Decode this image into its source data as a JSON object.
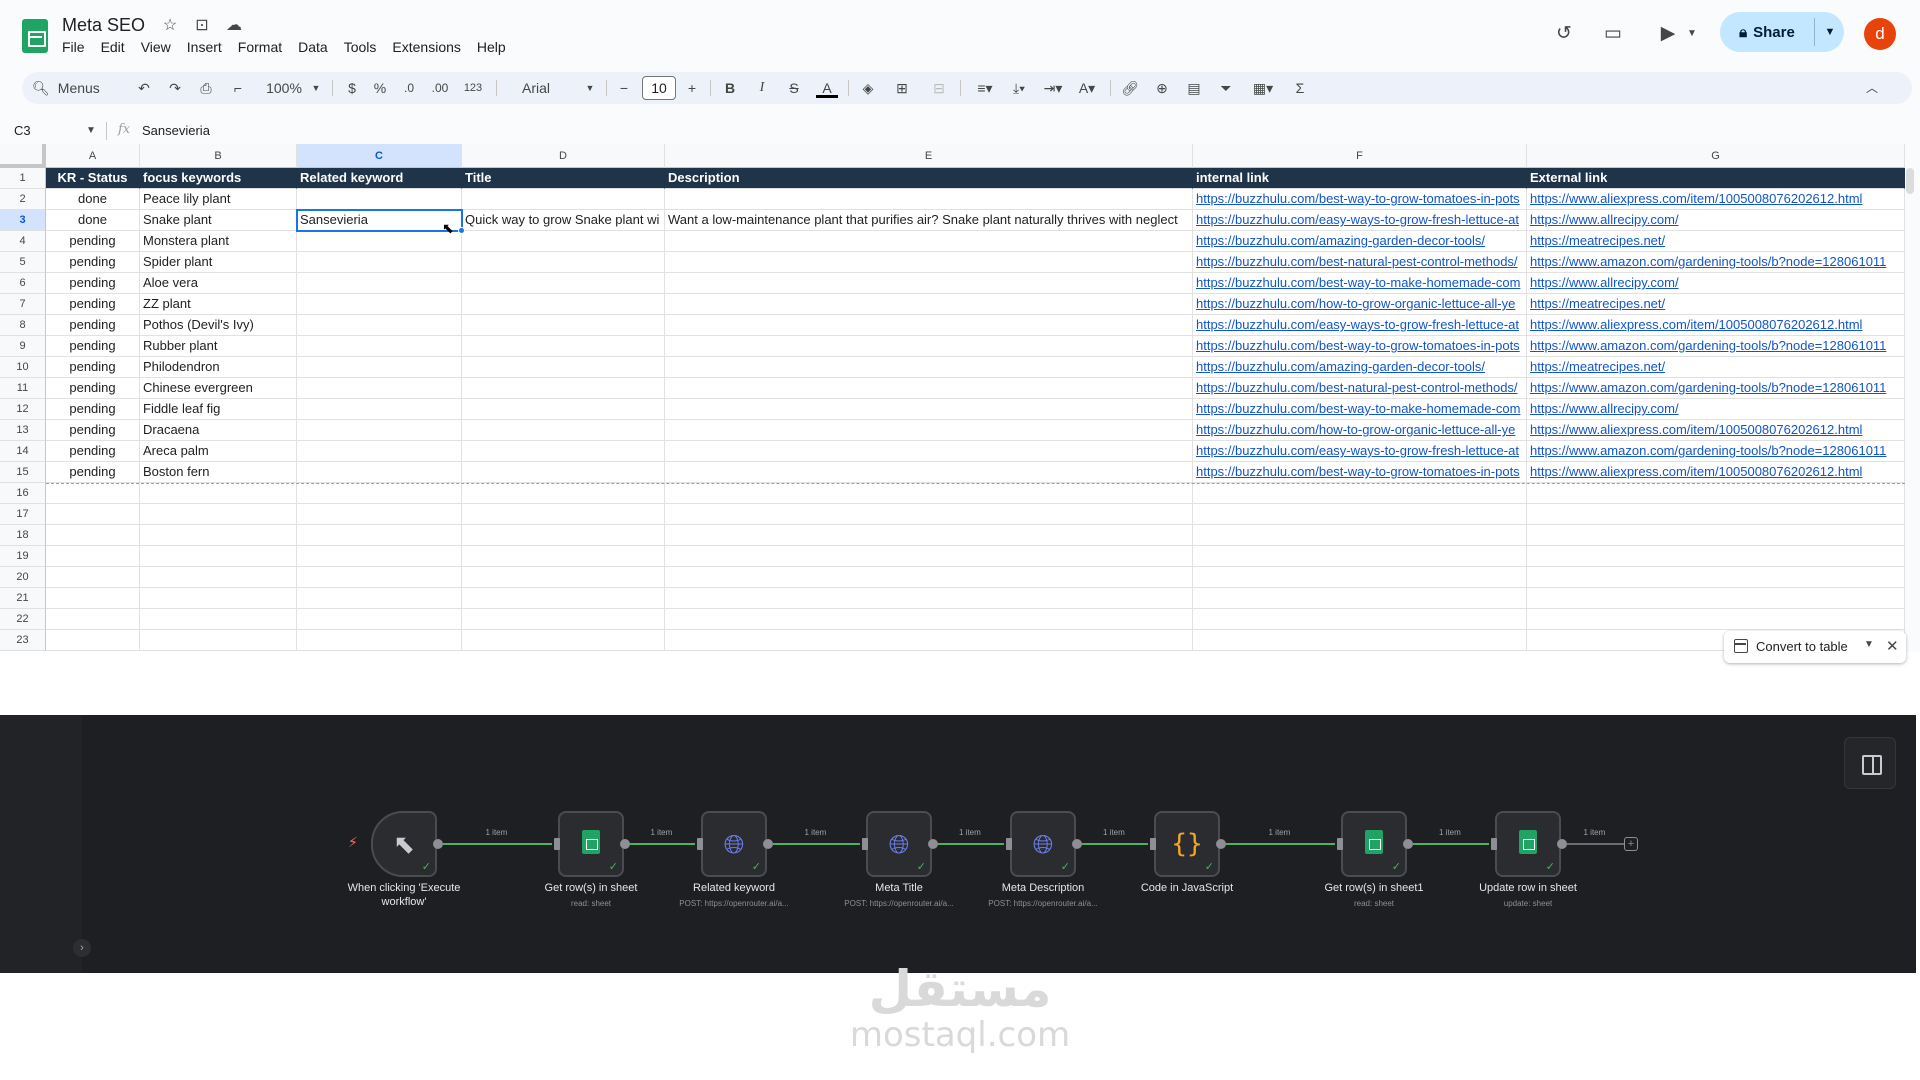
{
  "app": {
    "doc_title": "Meta SEO",
    "menu": [
      "File",
      "Edit",
      "View",
      "Insert",
      "Format",
      "Data",
      "Tools",
      "Extensions",
      "Help"
    ],
    "share_label": "Share",
    "avatar_letter": "d"
  },
  "toolbar": {
    "search_label": "Menus",
    "zoom": "100%",
    "currency": "$",
    "percent": "%",
    "dec_decrease": ".0",
    "dec_increase": ".00",
    "number_format": "123",
    "font": "Arial",
    "font_size": "10",
    "bold": "B",
    "italic": "I",
    "strike": "S",
    "text_color": "A",
    "sigma": "Σ"
  },
  "formula_bar": {
    "cell_ref": "C3",
    "fx": "fx",
    "value": "Sansevieria"
  },
  "grid": {
    "columns": [
      "A",
      "B",
      "C",
      "D",
      "E",
      "F",
      "G"
    ],
    "row_numbers": [
      "1",
      "2",
      "3",
      "4",
      "5",
      "6",
      "7",
      "8",
      "9",
      "10",
      "11",
      "12",
      "13",
      "14",
      "15",
      "16",
      "17",
      "18",
      "19",
      "20",
      "21",
      "22",
      "23"
    ],
    "header_row": [
      "KR -  Status",
      "focus keywords",
      "Related keyword",
      "Title",
      "Description",
      "internal link",
      "External link"
    ],
    "rows": [
      [
        "done",
        "Peace lily plant",
        "",
        "",
        "",
        "https://buzzhulu.com/best-way-to-grow-tomatoes-in-pots",
        "https://www.aliexpress.com/item/1005008076202612.html"
      ],
      [
        "done",
        "Snake plant",
        "Sansevieria",
        "Quick way to grow Snake plant wi",
        "Want a low-maintenance plant that purifies air? Snake plant naturally thrives with neglect",
        "https://buzzhulu.com/easy-ways-to-grow-fresh-lettuce-at",
        "https://www.allrecipy.com/"
      ],
      [
        "pending",
        "Monstera plant",
        "",
        "",
        "",
        "https://buzzhulu.com/amazing-garden-decor-tools/",
        "https://meatrecipes.net/"
      ],
      [
        "pending",
        "Spider plant",
        "",
        "",
        "",
        "https://buzzhulu.com/best-natural-pest-control-methods/",
        "https://www.amazon.com/gardening-tools/b?node=128061011"
      ],
      [
        "pending",
        "Aloe vera",
        "",
        "",
        "",
        "https://buzzhulu.com/best-way-to-make-homemade-com",
        "https://www.allrecipy.com/"
      ],
      [
        "pending",
        "ZZ plant",
        "",
        "",
        "",
        "https://buzzhulu.com/how-to-grow-organic-lettuce-all-ye",
        "https://meatrecipes.net/"
      ],
      [
        "pending",
        "Pothos (Devil's Ivy)",
        "",
        "",
        "",
        "https://buzzhulu.com/easy-ways-to-grow-fresh-lettuce-at",
        "https://www.aliexpress.com/item/1005008076202612.html"
      ],
      [
        "pending",
        "Rubber plant",
        "",
        "",
        "",
        "https://buzzhulu.com/best-way-to-grow-tomatoes-in-pots",
        "https://www.amazon.com/gardening-tools/b?node=128061011"
      ],
      [
        "pending",
        "Philodendron",
        "",
        "",
        "",
        "https://buzzhulu.com/amazing-garden-decor-tools/",
        "https://meatrecipes.net/"
      ],
      [
        "pending",
        "Chinese evergreen",
        "",
        "",
        "",
        "https://buzzhulu.com/best-natural-pest-control-methods/",
        "https://www.amazon.com/gardening-tools/b?node=128061011"
      ],
      [
        "pending",
        "Fiddle leaf fig",
        "",
        "",
        "",
        "https://buzzhulu.com/best-way-to-make-homemade-com",
        "https://www.allrecipy.com/"
      ],
      [
        "pending",
        "Dracaena",
        "",
        "",
        "",
        "https://buzzhulu.com/how-to-grow-organic-lettuce-all-ye",
        "https://www.aliexpress.com/item/1005008076202612.html"
      ],
      [
        "pending",
        "Areca palm",
        "",
        "",
        "",
        "https://buzzhulu.com/easy-ways-to-grow-fresh-lettuce-at",
        "https://www.amazon.com/gardening-tools/b?node=128061011"
      ],
      [
        "pending",
        "Boston fern",
        "",
        "",
        "",
        "https://buzzhulu.com/best-way-to-grow-tomatoes-in-pots",
        "https://www.aliexpress.com/item/1005008076202612.html"
      ]
    ],
    "convert_to_table": "Convert to table"
  },
  "workflow": {
    "connection_label": "1 item",
    "nodes": [
      {
        "label": "When clicking 'Execute workflow'",
        "sub": "",
        "icon": "pointer-icon"
      },
      {
        "label": "Get row(s) in sheet",
        "sub": "read: sheet",
        "icon": "google-sheets-icon"
      },
      {
        "label": "Related keyword",
        "sub": "POST: https://openrouter.ai/a...",
        "icon": "globe-icon"
      },
      {
        "label": "Meta Title",
        "sub": "POST: https://openrouter.ai/a...",
        "icon": "globe-icon"
      },
      {
        "label": "Meta Description",
        "sub": "POST: https://openrouter.ai/a...",
        "icon": "globe-icon"
      },
      {
        "label": "Code in JavaScript",
        "sub": "",
        "icon": "code-icon"
      },
      {
        "label": "Get row(s) in sheet1",
        "sub": "read: sheet",
        "icon": "google-sheets-icon"
      },
      {
        "label": "Update row in sheet",
        "sub": "update: sheet",
        "icon": "google-sheets-icon"
      }
    ]
  },
  "watermark": {
    "arabic": "مستقل",
    "latin": "mostaql.com"
  },
  "colors": {
    "header_bg": "#1f3449",
    "link": "#1155cc",
    "selection": "#1a73e8",
    "n8n_bg": "#1e1f22",
    "connection": "#4db15f",
    "share_bg": "#c2e7ff"
  }
}
